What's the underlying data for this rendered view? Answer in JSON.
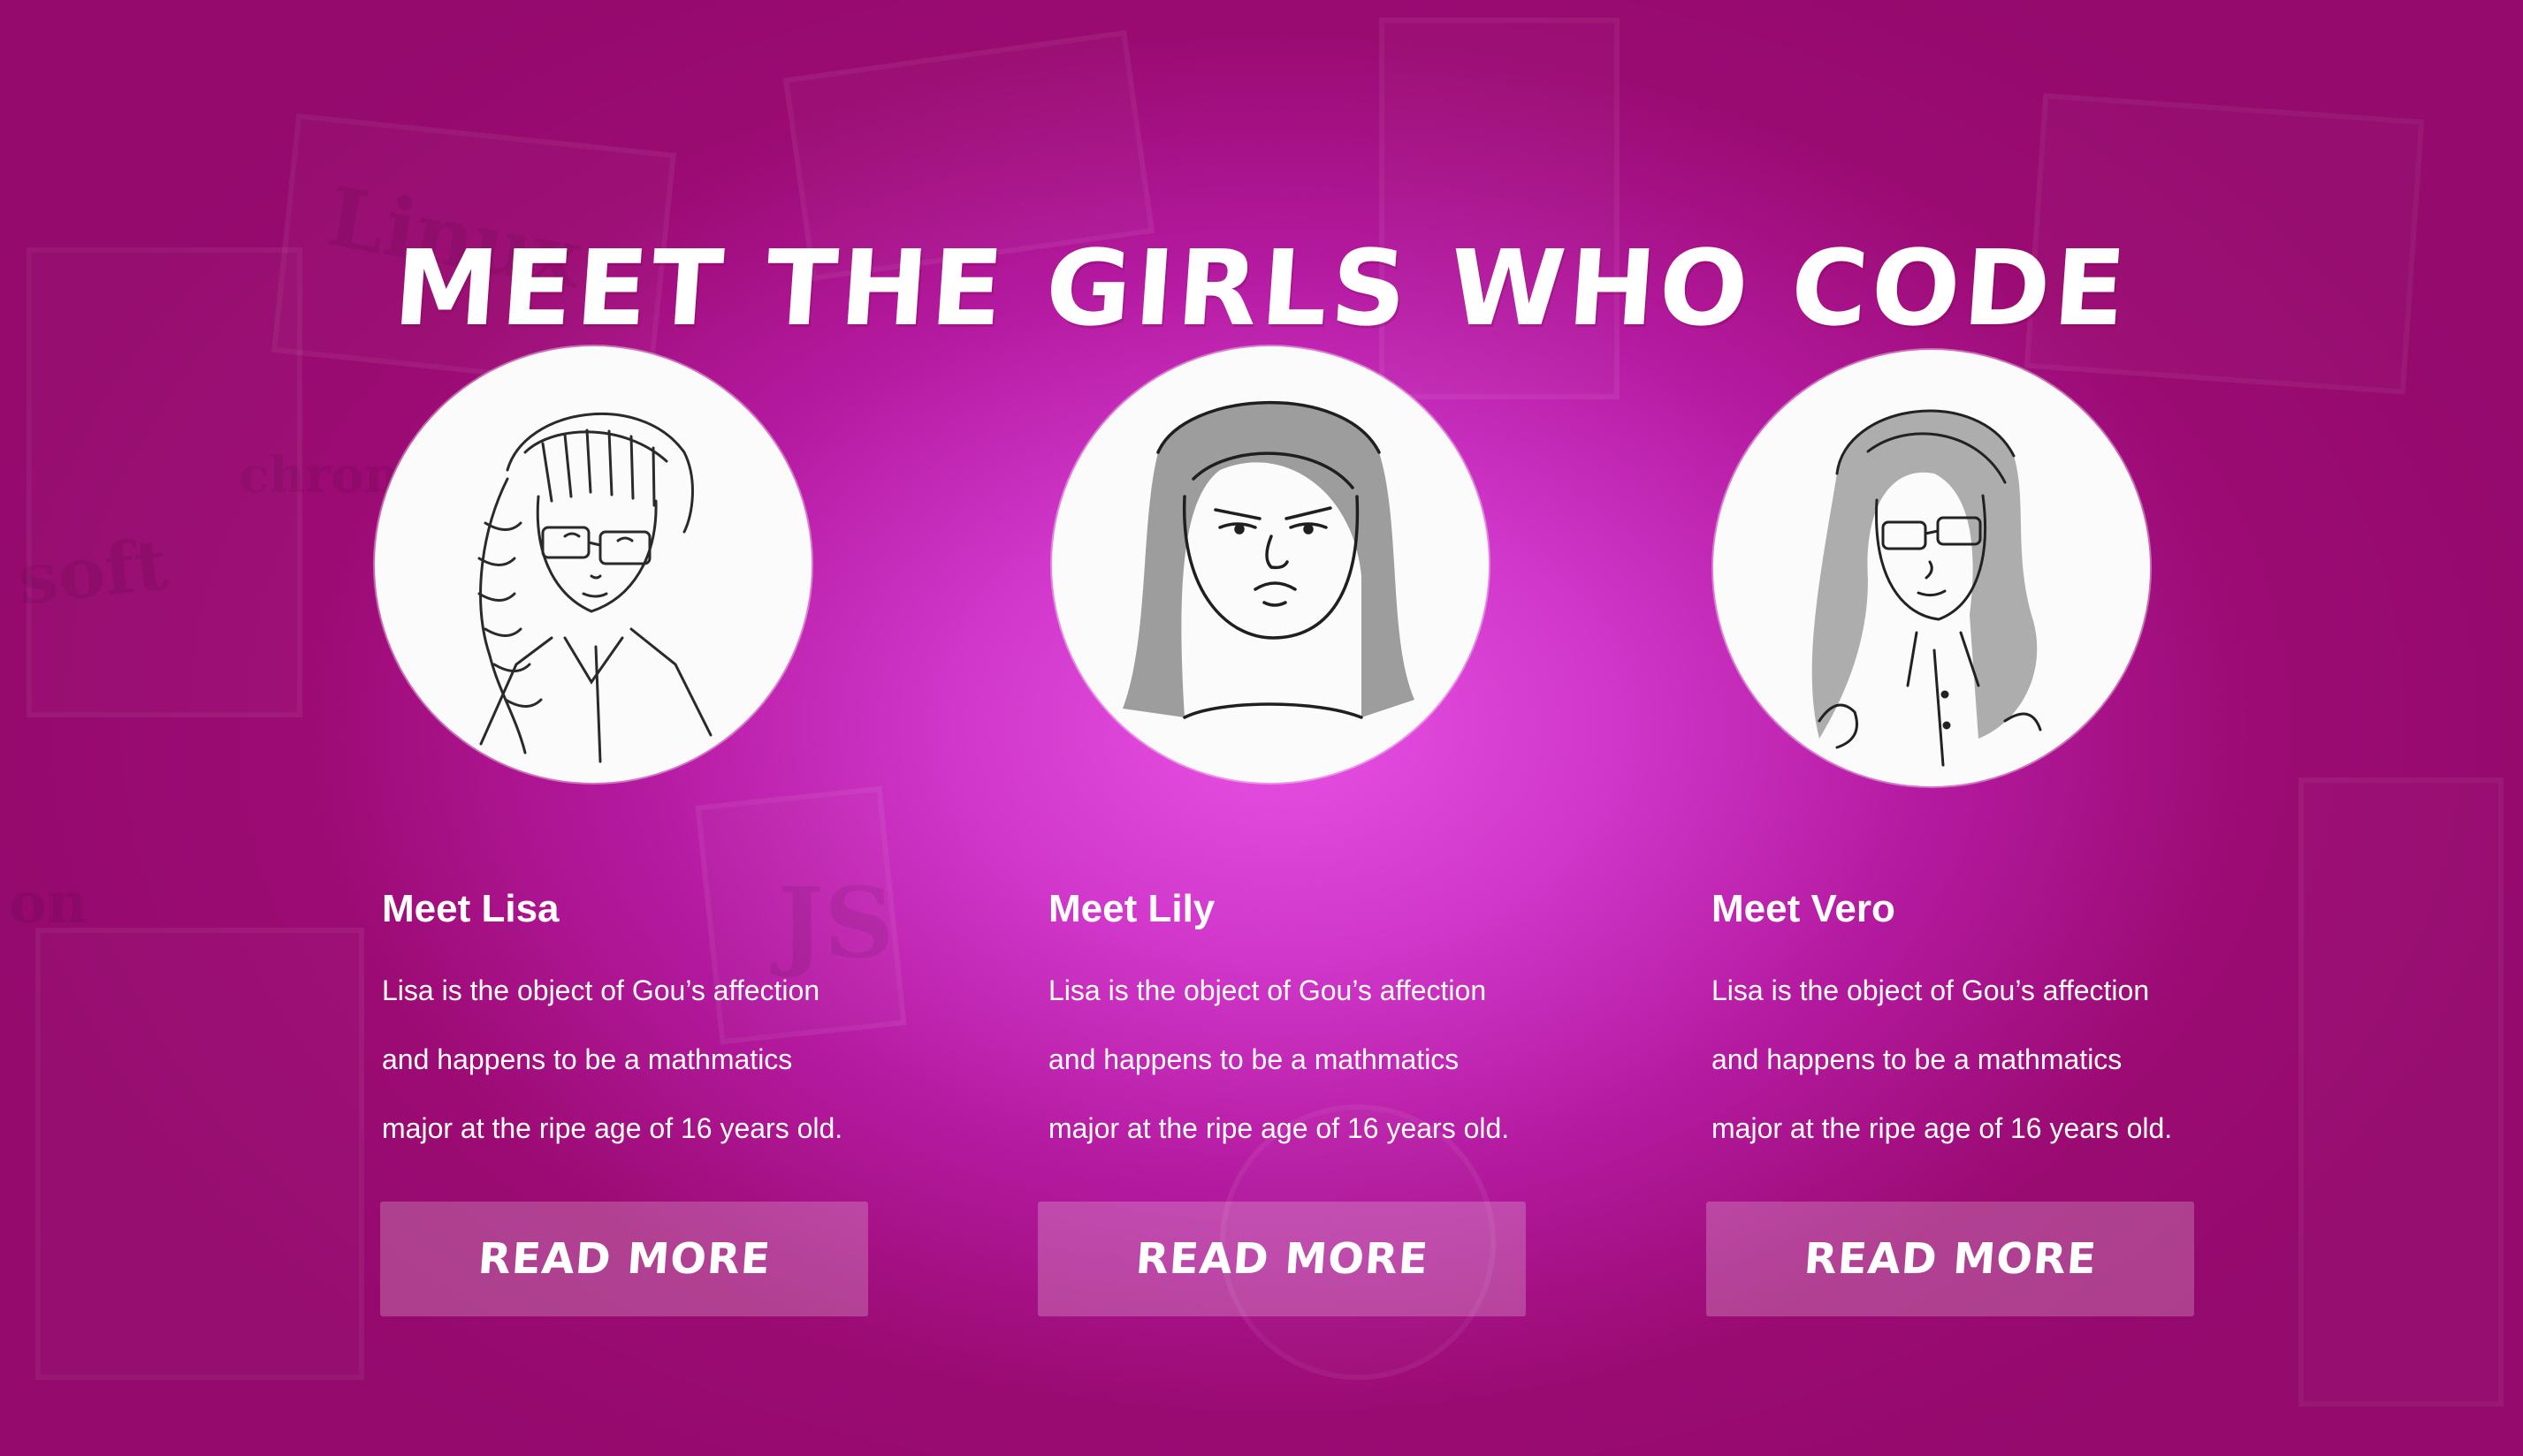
{
  "section": {
    "title": "MEET THE GIRLS WHO CODE"
  },
  "cards": [
    {
      "name": "Meet Lisa",
      "desc_lines": [
        "Lisa is the object of Gou’s affection",
        "and happens to be a mathmatics",
        "major at the ripe age of 16 years old."
      ],
      "button": "READ MORE",
      "avatar_icon": "sketch-portrait-braids-glasses"
    },
    {
      "name": "Meet Lily",
      "desc_lines": [
        "Lisa is the object of Gou’s affection",
        "and happens to be a mathmatics",
        "major at the ripe age of 16 years old."
      ],
      "button": "READ MORE",
      "avatar_icon": "sketch-portrait-grumpy"
    },
    {
      "name": "Meet Vero",
      "desc_lines": [
        "Lisa is the object of Gou’s affection",
        "and happens to be a mathmatics",
        "major at the ripe age of 16 years old."
      ],
      "button": "READ MORE",
      "avatar_icon": "sketch-portrait-long-hair-glasses"
    }
  ],
  "background": {
    "words": [
      "Linux",
      "chrom",
      "soft",
      "JS",
      "on"
    ]
  },
  "colors": {
    "bg_center": "#e751e3",
    "bg_edge": "#a10c78",
    "text": "#ffffff",
    "button_bg": "rgba(255,255,255,0.22)"
  }
}
